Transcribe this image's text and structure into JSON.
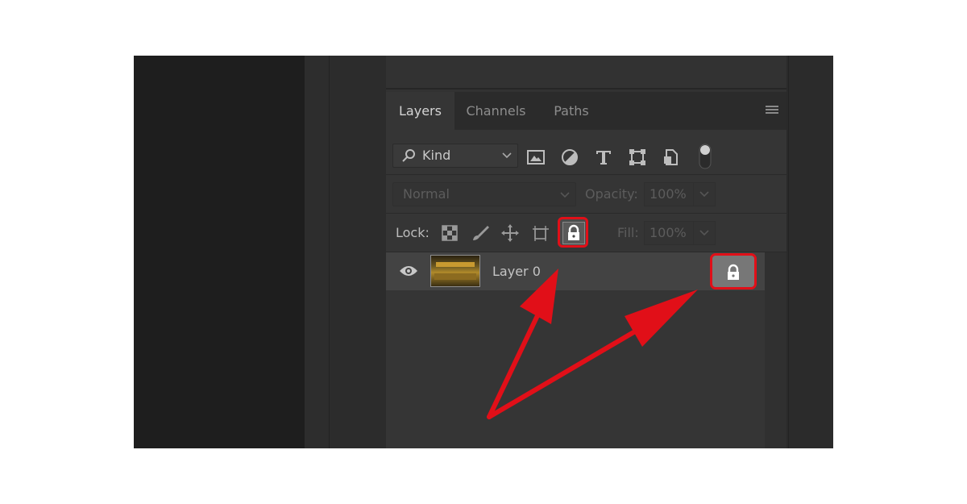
{
  "tabs": [
    {
      "label": "Layers",
      "active": true
    },
    {
      "label": "Channels",
      "active": false
    },
    {
      "label": "Paths",
      "active": false
    }
  ],
  "filter": {
    "kind_label": "Kind",
    "icons": [
      "image-filter-icon",
      "adjustment-filter-icon",
      "type-filter-icon",
      "shape-filter-icon",
      "smart-object-filter-icon",
      "filter-toggle-icon"
    ]
  },
  "blend": {
    "mode": "Normal",
    "opacity_label": "Opacity:",
    "opacity_value": "100%"
  },
  "lock": {
    "label": "Lock:",
    "fill_label": "Fill:",
    "fill_value": "100%",
    "icons": [
      "lock-transparent-pixels-icon",
      "lock-image-pixels-icon",
      "lock-position-icon",
      "lock-artboard-icon",
      "lock-all-icon"
    ]
  },
  "layers": [
    {
      "name": "Layer 0",
      "visible": true,
      "locked": true
    }
  ],
  "colors": {
    "highlight": "#e10f18",
    "panel": "#353535",
    "selected_row": "#434343"
  }
}
